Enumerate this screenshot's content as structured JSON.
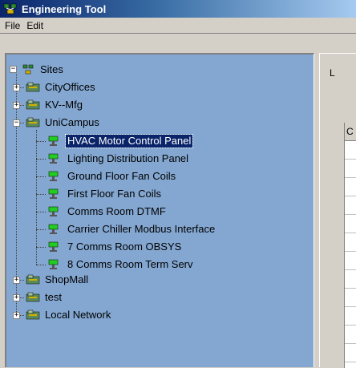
{
  "window": {
    "title": "Engineering Tool"
  },
  "menu": {
    "file": "File",
    "edit": "Edit"
  },
  "right_panel": {
    "label": "L",
    "grid_header": "C"
  },
  "tree": {
    "root": "Sites",
    "sites": [
      "CityOffices",
      "KV--Mfg",
      "UniCampus",
      "ShopMall",
      "test",
      "Local Network"
    ],
    "unicampus_children": [
      "HVAC Motor Control Panel",
      "Lighting Distribution Panel",
      "Ground Floor Fan Coils",
      "First Floor Fan Coils",
      "Comms Room DTMF",
      "Carrier Chiller Modbus Interface",
      "7 Comms Room OBSYS",
      "8 Comms Room Term Serv"
    ],
    "selected": "HVAC Motor Control Panel"
  },
  "colors": {
    "tree_bg": "#84a7d1",
    "selection": "#0a246a",
    "title_bar": "#0a246a"
  }
}
